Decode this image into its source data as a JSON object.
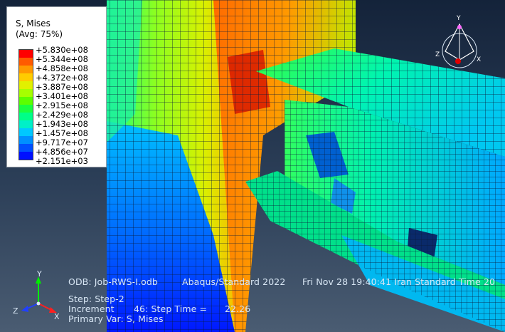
{
  "legend": {
    "title": "S, Mises",
    "subtitle": "(Avg: 75%)",
    "colors": [
      "#ff0000",
      "#ff5a00",
      "#ff9900",
      "#ffcc00",
      "#e1f000",
      "#a6ff00",
      "#5cff00",
      "#1aff40",
      "#00ff88",
      "#00f0c8",
      "#00c8ff",
      "#0090ff",
      "#0050ff",
      "#0010ff"
    ],
    "values": [
      "+5.830e+08",
      "+5.344e+08",
      "+4.858e+08",
      "+4.372e+08",
      "+3.887e+08",
      "+3.401e+08",
      "+2.915e+08",
      "+2.429e+08",
      "+1.943e+08",
      "+1.457e+08",
      "+9.717e+07",
      "+4.856e+07",
      "+2.151e+03"
    ]
  },
  "info": {
    "odb": "ODB: Job-RWS-I.odb",
    "solver": "Abaqus/Standard 2022",
    "date": "Fri Nov 28 19:40:41 Iran Standard Time 20",
    "step": "Step: Step-2",
    "increment": "Increment",
    "increment_value": "46: Step Time =",
    "step_time": "22.26",
    "primary_var": "Primary Var: S, Mises"
  },
  "triad": {
    "x": "X",
    "y": "Y",
    "z": "Z"
  },
  "viewcube": {
    "x": "X",
    "y": "Y",
    "z": "Z"
  }
}
